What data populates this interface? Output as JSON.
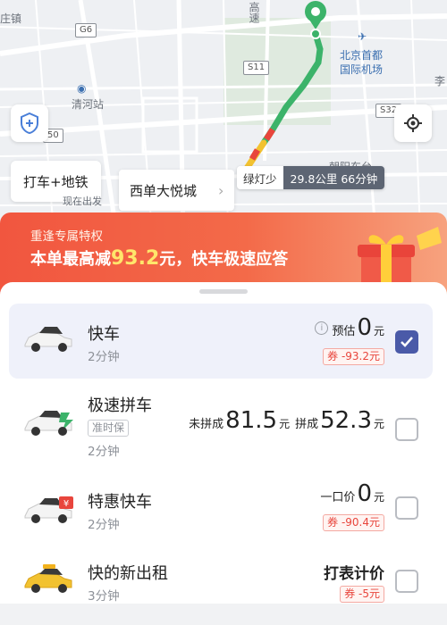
{
  "map": {
    "labels": {
      "zhuangzhen": "庄镇",
      "gaosu": "高速",
      "airport": "北京首都国际机场",
      "airport_line1": "北京首都",
      "airport_line2": "国际机场",
      "qinghe": "清河站",
      "li": "李",
      "district": "朝阳东台"
    },
    "shields": {
      "g6": "G6",
      "s11": "S11",
      "s32": "S32",
      "r50": "50"
    },
    "route_color": "#3cb36a",
    "traffic_colors": [
      "#f2c230",
      "#e8453c"
    ]
  },
  "chips": {
    "taxi_subway": "打车+地铁",
    "destination": "西单大悦城",
    "destination_sub": "现在出发"
  },
  "traffic": {
    "tip": "绿灯少",
    "distance_time": "29.8公里 66分钟"
  },
  "promo": {
    "subtitle": "重逢专属特权",
    "title_prefix": "本单最高减",
    "amount": "93.2",
    "title_suffix": "元，快车极速应答"
  },
  "rides": [
    {
      "name": "快车",
      "eta": "2分钟",
      "price_label": "预估",
      "price": "0",
      "unit": "元",
      "coupon": "券 -93.2元",
      "selected": true
    },
    {
      "name": "极速拼车",
      "tag": "准时保",
      "eta": "2分钟",
      "price_label_a": "未拼成",
      "price_a": "81.5",
      "unit_a": "元",
      "price_label_b": "拼成",
      "price_b": "52.3",
      "unit_b": "元",
      "selected": false
    },
    {
      "name": "特惠快车",
      "eta": "2分钟",
      "price_label": "一口价",
      "price": "0",
      "unit": "元",
      "coupon": "券 -90.4元",
      "selected": false
    },
    {
      "name": "快的新出租",
      "eta": "3分钟",
      "meter": "打表计价",
      "coupon": "券 -5元",
      "selected": false
    }
  ],
  "colors": {
    "accent": "#4a5aa8",
    "promo": "#f1563f",
    "coupon": "#e8453c"
  }
}
